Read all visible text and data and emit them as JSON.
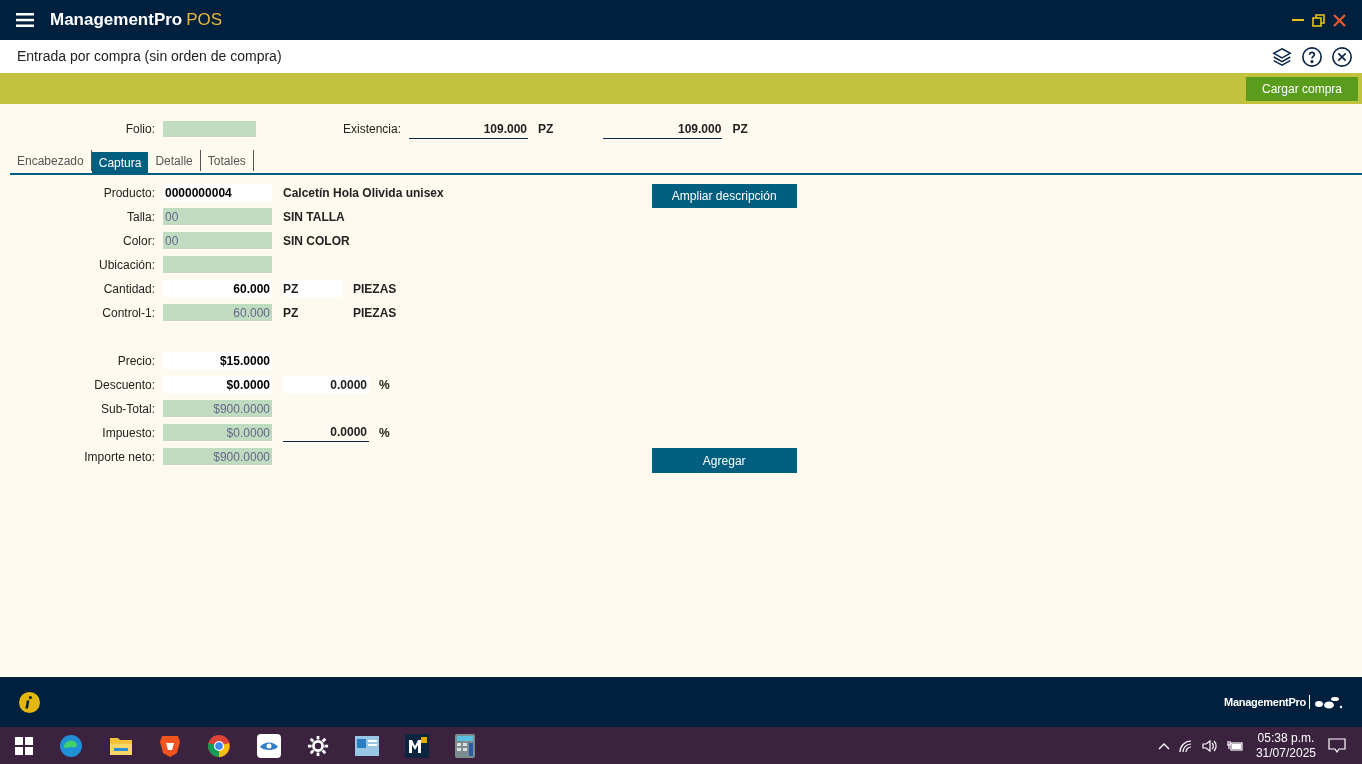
{
  "app": {
    "brand": "ManagementPro",
    "product": "POS"
  },
  "screen": {
    "title": "Entrada por compra (sin orden de compra)"
  },
  "action_bar": {
    "button": "Cargar compra"
  },
  "header": {
    "folio_label": "Folio:",
    "existencia_label": "Existencia:",
    "stock": [
      {
        "value": "109.000",
        "unit": "PZ"
      },
      {
        "value": "109.000",
        "unit": "PZ"
      }
    ]
  },
  "tabs": [
    {
      "label": "Encabezado",
      "selected": false
    },
    {
      "label": "Captura",
      "selected": true
    },
    {
      "label": "Detalle",
      "selected": false
    },
    {
      "label": "Totales",
      "selected": false
    }
  ],
  "sections": [
    {
      "rows": [
        {
          "label": "Producto:",
          "value": "0000000004",
          "readonly": false,
          "kind": "code",
          "extras": [
            {
              "kind": "description",
              "text": "Calcetín Hola Olivida unisex"
            }
          ]
        },
        {
          "label": "Talla:",
          "value": "00",
          "readonly": true,
          "kind": "code",
          "extras": [
            {
              "kind": "description",
              "text": "SIN TALLA"
            }
          ]
        },
        {
          "label": "Color:",
          "value": "00",
          "readonly": true,
          "kind": "code",
          "extras": [
            {
              "kind": "description",
              "text": "SIN COLOR"
            }
          ]
        },
        {
          "label": "Ubicación:",
          "readonly": true,
          "kind": "code",
          "extras": []
        },
        {
          "label": "Cantidad:",
          "value": "60.000",
          "readonly": false,
          "kind": "amount",
          "extras": [
            {
              "kind": "unit-input",
              "text": "PZ"
            },
            {
              "kind": "description",
              "text": "PIEZAS"
            }
          ]
        },
        {
          "label": "Control-1:",
          "value": "60.000",
          "readonly": true,
          "kind": "amount",
          "extras": [
            {
              "kind": "unit",
              "text": "PZ"
            },
            {
              "kind": "description",
              "text": "PIEZAS"
            }
          ]
        }
      ]
    },
    {
      "rows": [
        {
          "label": "Precio:",
          "value": "$15.0000",
          "readonly": false,
          "kind": "amount",
          "extras": []
        },
        {
          "label": "Descuento:",
          "value": "$0.0000",
          "readonly": false,
          "kind": "amount",
          "extras": [
            {
              "kind": "percent-input",
              "text": "0.0000"
            },
            {
              "kind": "symbol",
              "text": "%"
            }
          ]
        },
        {
          "label": "Sub-Total:",
          "value": "$900.0000",
          "readonly": true,
          "kind": "amount",
          "extras": []
        },
        {
          "label": "Impuesto:",
          "value": "$0.0000",
          "readonly": true,
          "kind": "amount",
          "extras": [
            {
              "kind": "percent-line",
              "text": "0.0000"
            },
            {
              "kind": "symbol",
              "text": "%"
            }
          ]
        },
        {
          "label": "Importe neto:",
          "value": "$900.0000",
          "readonly": true,
          "kind": "amount",
          "extras": []
        }
      ]
    }
  ],
  "side_buttons": {
    "top": "Ampliar descripción",
    "bottom": "Agregar"
  },
  "footer": {
    "logo": "ManagementPro"
  },
  "taskbar": {
    "time": "05:38 p.m.",
    "date": "31/07/2025"
  }
}
